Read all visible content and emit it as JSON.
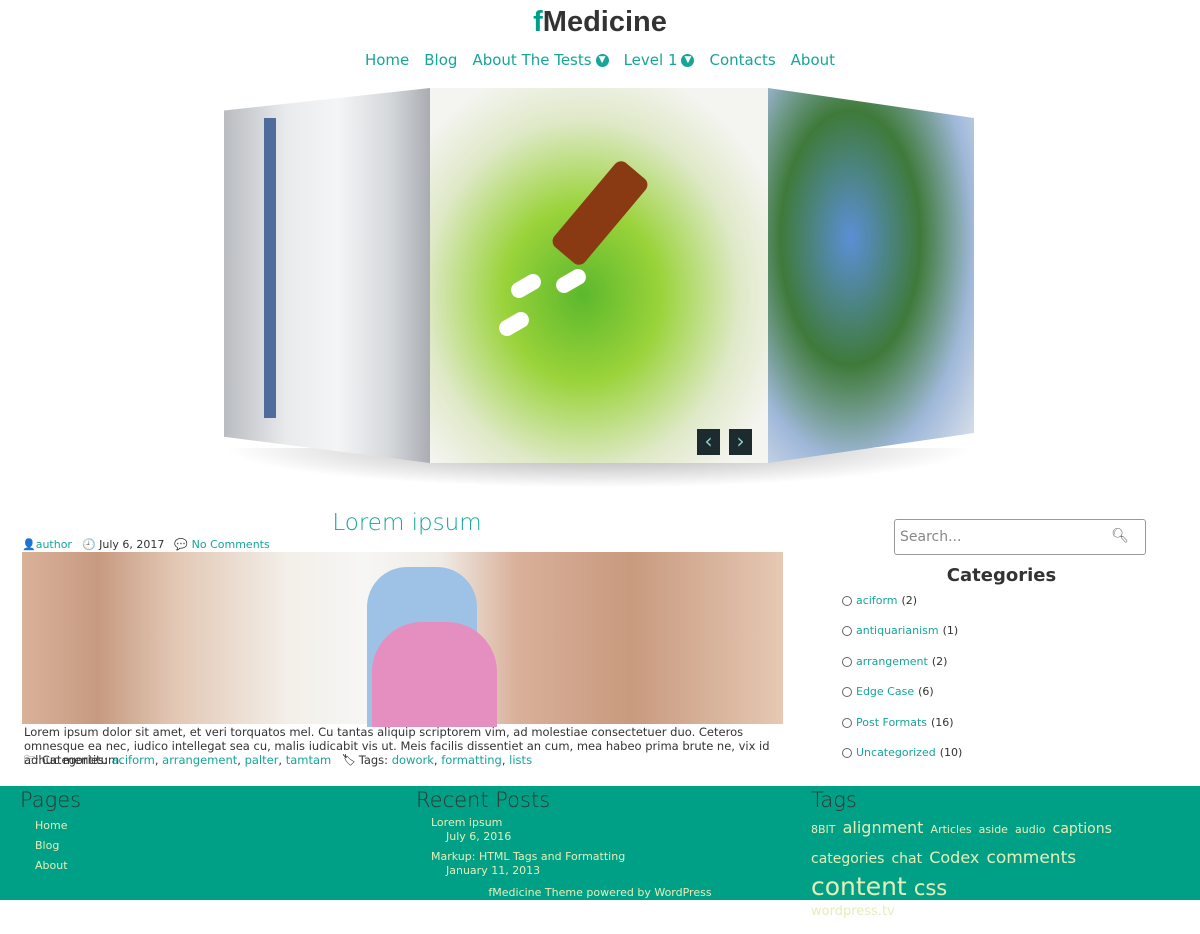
{
  "site": {
    "logo_first": "f",
    "logo_rest": "Medicine"
  },
  "nav": [
    {
      "label": "Home"
    },
    {
      "label": "Blog"
    },
    {
      "label": "About The Tests",
      "dropdown": true
    },
    {
      "label": "Level 1",
      "dropdown": true
    },
    {
      "label": "Contacts"
    },
    {
      "label": "About"
    }
  ],
  "slider": {
    "prev_icon": "chevron-left-icon",
    "next_icon": "chevron-right-icon"
  },
  "post": {
    "title": "Lorem ipsum",
    "author": "author",
    "date": "July 6, 2017",
    "comments": "No Comments",
    "excerpt": "Lorem ipsum dolor sit amet, et veri torquatos mel. Cu tantas aliquip scriptorem vim, ad molestiae consectetuer duo. Ceteros omnesque ea nec, iudico intellegat sea cu, malis iudicabit vis ut. Meis facilis dissentiet an cum, mea habeo prima brute ne, vix id adhuc mentitum.",
    "categories_label": "Categories:",
    "categories": [
      "aciform",
      "arrangement",
      "palter",
      "tamtam"
    ],
    "tags_label": "Tags:",
    "tags": [
      "dowork",
      "formatting",
      "lists"
    ]
  },
  "sidebar": {
    "search_placeholder": "Search...",
    "categories_title": "Categories",
    "categories": [
      {
        "name": "aciform",
        "count": "(2)"
      },
      {
        "name": "antiquarianism",
        "count": "(1)"
      },
      {
        "name": "arrangement",
        "count": "(2)"
      },
      {
        "name": "Edge Case",
        "count": "(6)"
      },
      {
        "name": "Post Formats",
        "count": "(16)"
      },
      {
        "name": "Uncategorized",
        "count": "(10)"
      }
    ]
  },
  "footer": {
    "pages_title": "Pages",
    "pages": [
      "Home",
      "Blog",
      "About"
    ],
    "recent_title": "Recent Posts",
    "recent": [
      {
        "title": "Lorem ipsum",
        "date": "July 6, 2016"
      },
      {
        "title": "Markup: HTML Tags and Formatting",
        "date": "January 11, 2013"
      }
    ],
    "tags_title": "Tags",
    "tags": [
      "8BIT",
      "alignment",
      "Articles",
      "aside",
      "audio",
      "captions",
      "categories",
      "chat",
      "Codex",
      "comments",
      "content",
      "css",
      "wordpress.tv"
    ],
    "powered": "fMedicine Theme powered by WordPress"
  },
  "colors": {
    "accent": "#17a598",
    "footer_bg": "#00a087",
    "footer_link": "#e6edb8"
  }
}
